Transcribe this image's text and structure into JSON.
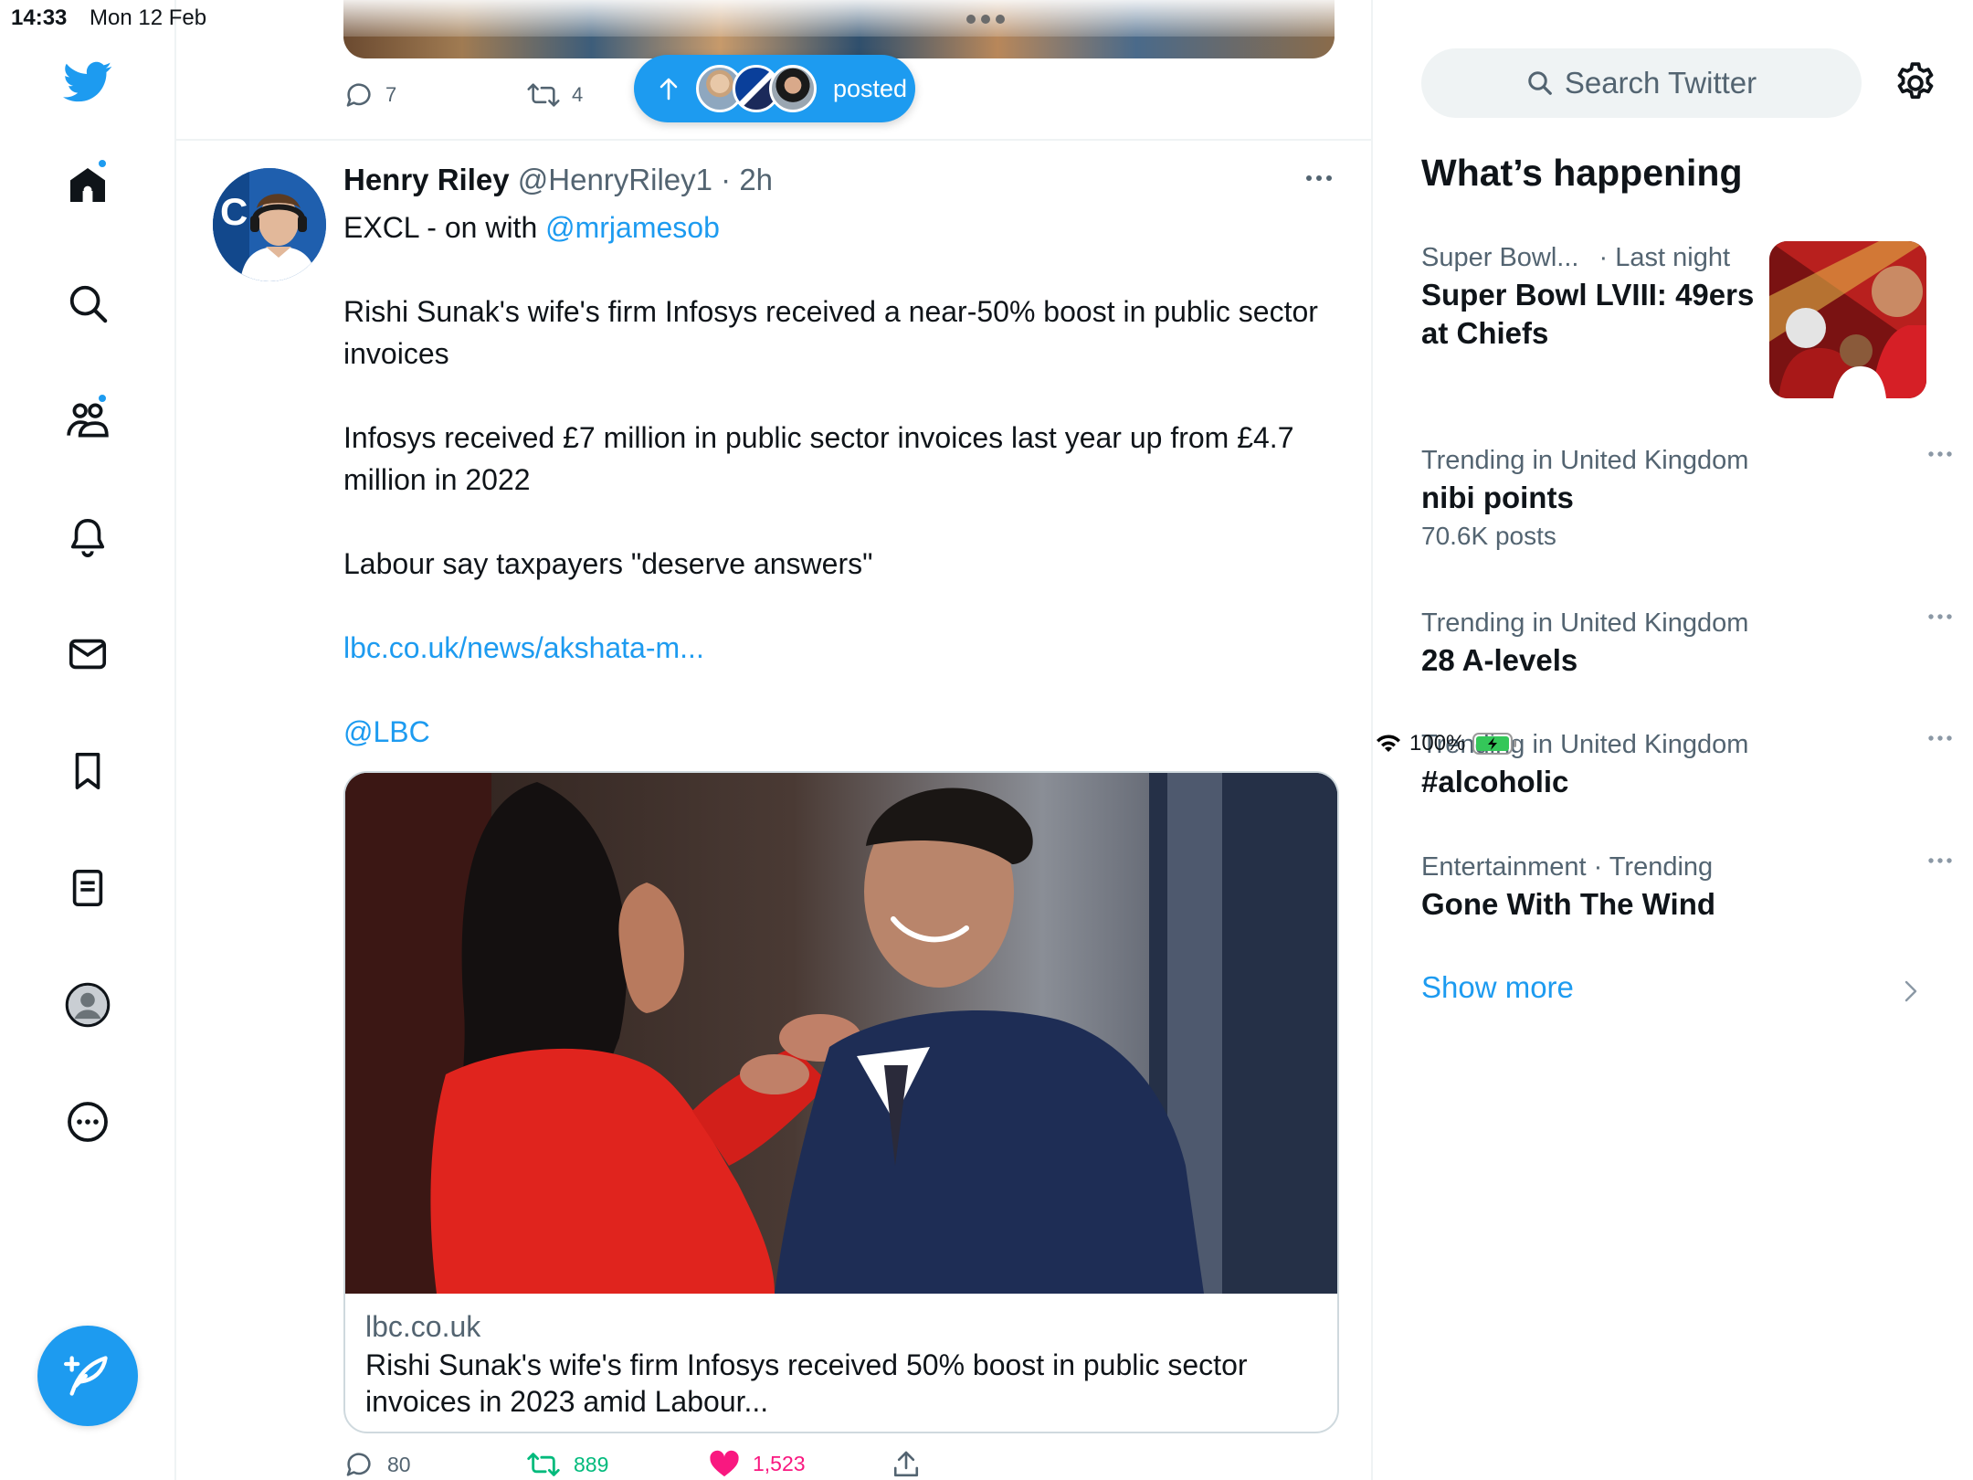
{
  "status_bar": {
    "time": "14:33",
    "date": "Mon 12 Feb",
    "battery": "100%"
  },
  "left_nav": {
    "items": [
      {
        "name": "home",
        "icon": "home-icon",
        "active": true,
        "badge": true
      },
      {
        "name": "explore",
        "icon": "search-icon"
      },
      {
        "name": "communities",
        "icon": "communities-icon",
        "badge": true
      },
      {
        "name": "notifications",
        "icon": "bell-icon"
      },
      {
        "name": "messages",
        "icon": "mail-icon"
      },
      {
        "name": "bookmarks",
        "icon": "bookmark-icon"
      },
      {
        "name": "lists",
        "icon": "list-icon"
      },
      {
        "name": "profile",
        "icon": "avatar-icon"
      },
      {
        "name": "more",
        "icon": "more-circle-icon"
      }
    ],
    "compose_icon": "compose-feather-icon"
  },
  "previous_tweet": {
    "replies": "7",
    "retweets": "4"
  },
  "new_posts_pill": {
    "label": "posted"
  },
  "tweet": {
    "name": "Henry Riley",
    "handle": "@HenryRiley1",
    "time": "· 2h",
    "line1_prefix": "EXCL - on with ",
    "line1_mention": "@mrjamesob",
    "para1": "Rishi Sunak's wife's firm Infosys received a near-50% boost in public sector invoices",
    "para2": "Infosys received £7 million in public sector invoices last year up from £4.7 million in 2022",
    "para3": "Labour say taxpayers \"deserve answers\"",
    "link": "lbc.co.uk/news/akshata-m...",
    "mention2": "@LBC",
    "card": {
      "domain": "lbc.co.uk",
      "title": "Rishi Sunak's wife's firm Infosys received 50% boost in public sector invoices in 2023 amid Labour..."
    },
    "replies": "80",
    "retweets": "889",
    "likes": "1,523"
  },
  "right_panel": {
    "search_placeholder": "Search Twitter",
    "section_title": "What’s happening",
    "trends": [
      {
        "meta": "Super Bowl...",
        "meta2": "· Last night",
        "topic": "Super Bowl LVIII: 49ers at Chiefs"
      },
      {
        "meta": "Trending in United Kingdom",
        "topic": "nibi points",
        "count": "70.6K posts"
      },
      {
        "meta": "Trending in United Kingdom",
        "topic": "28 A-levels"
      },
      {
        "meta": "Trending in United Kingdom",
        "topic": "#alcoholic"
      },
      {
        "meta": "Entertainment · Trending",
        "topic": "Gone With The Wind"
      }
    ],
    "show_more": "Show more"
  },
  "colors": {
    "accent": "#1d9bf0",
    "retweet": "#00ba7c",
    "like": "#f91880",
    "muted": "#536471"
  }
}
